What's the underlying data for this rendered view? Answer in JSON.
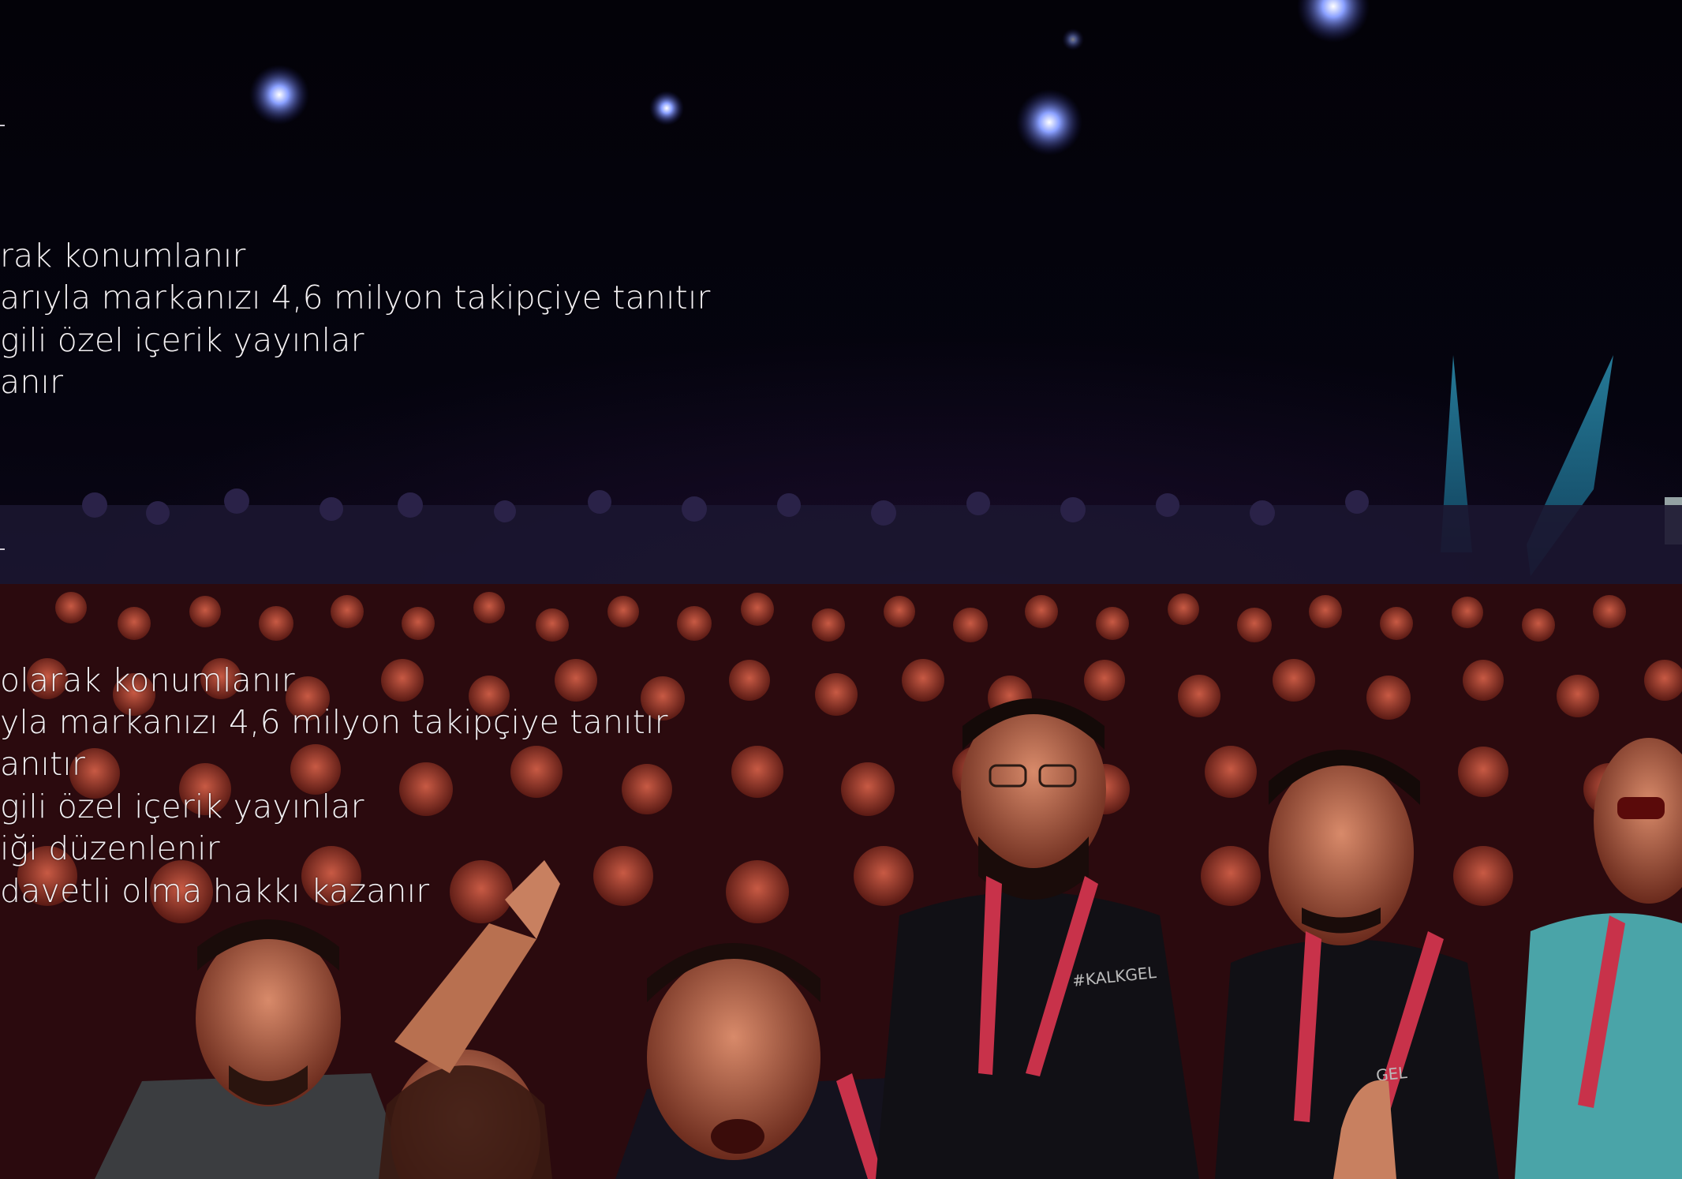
{
  "group1": {
    "lines": [
      "rak konumlanır",
      "arıyla markanızı 4,6 milyon takipçiye tanıtır",
      "gili özel içerik yayınlar",
      "anır"
    ]
  },
  "group2": {
    "lines": [
      "olarak konumlanır",
      "yla markanızı 4,6 milyon takipçiye tanıtır",
      "anıtır",
      "gili özel içerik yayınlar",
      "iği düzenlenir",
      "davetli olma hakkı kazanır"
    ]
  },
  "photo": {
    "shirt_text_1": "#KALKGEL",
    "shirt_text_2": "GEL"
  },
  "colors": {
    "text": "#f4f1f4",
    "background": "#050308",
    "lanyard": "#c8324a",
    "stage_light": "#6f8cff"
  }
}
